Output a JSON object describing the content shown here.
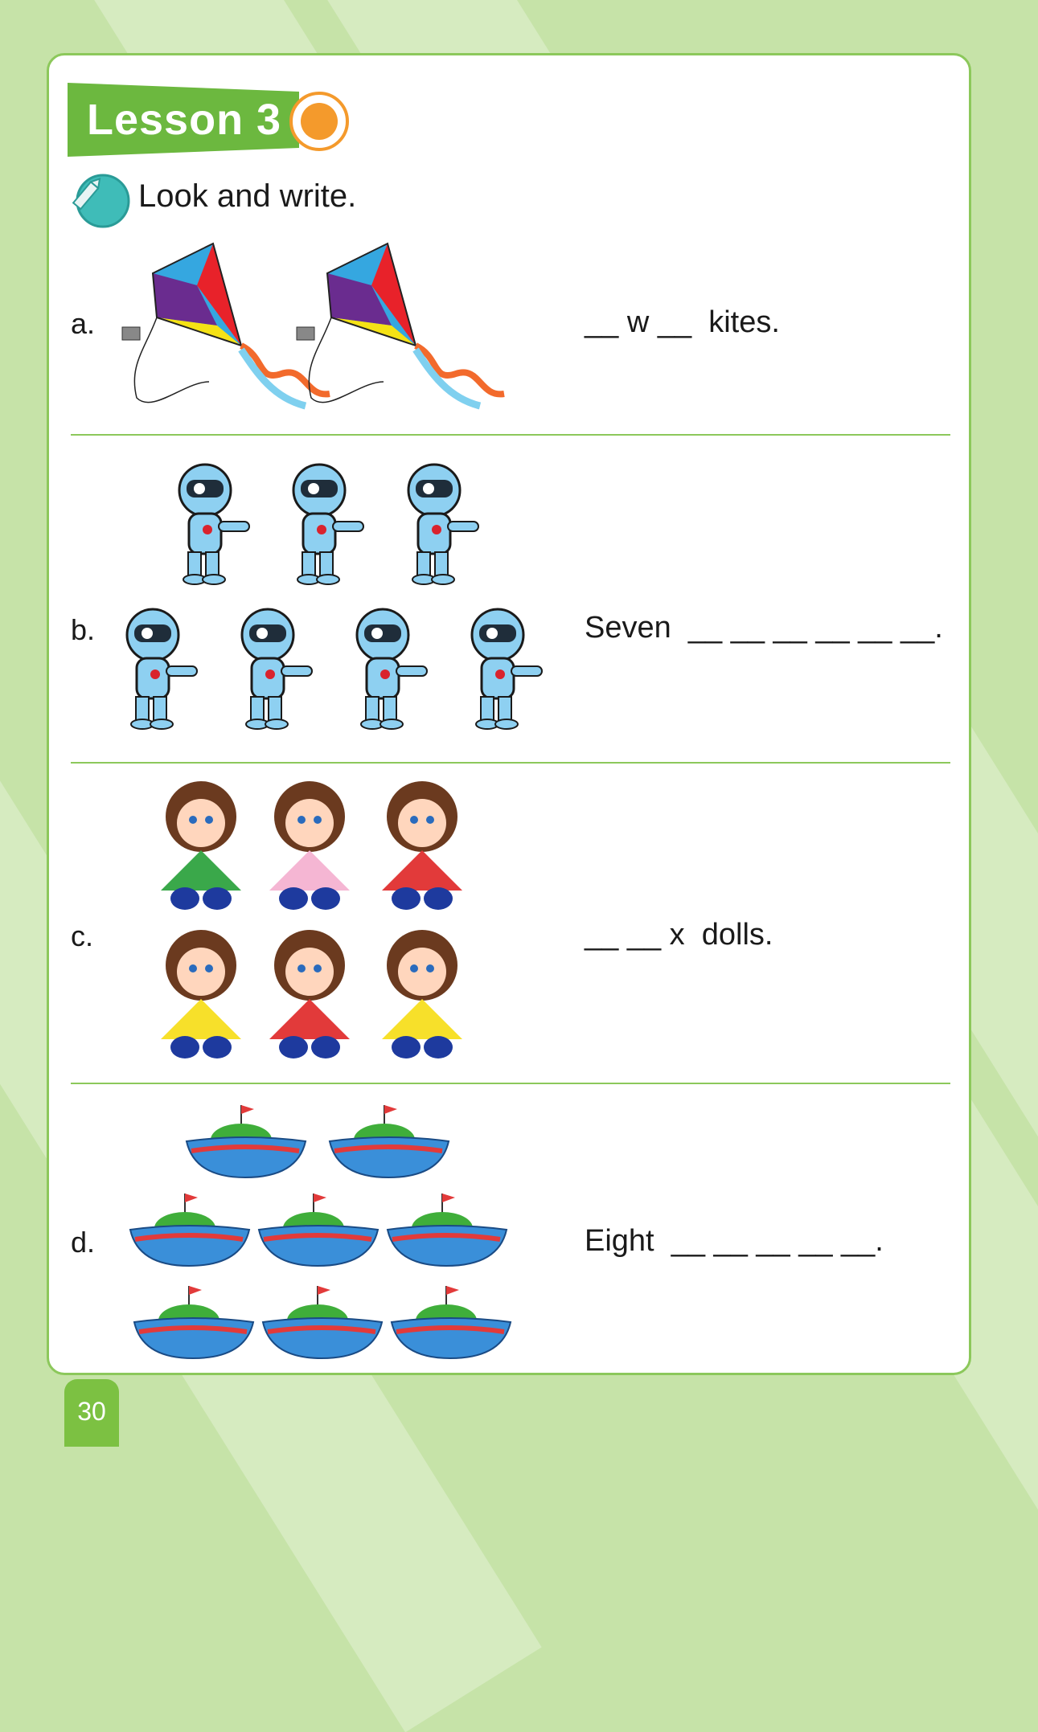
{
  "page": {
    "lesson_title": "Lesson 3",
    "instruction": "Look and write.",
    "page_number": "30"
  },
  "items": [
    {
      "label": "a.",
      "answer": "__ w __  kites.",
      "picture": "kite",
      "count": 2
    },
    {
      "label": "b.",
      "answer": "Seven  __ __ __ __ __ __.",
      "picture": "robot",
      "count": 7
    },
    {
      "label": "c.",
      "answer": "__ __ x  dolls.",
      "picture": "doll",
      "count": 6
    },
    {
      "label": "d.",
      "answer": "Eight  __ __ __ __ __.",
      "picture": "boat",
      "count": 8
    }
  ],
  "icons": [
    "pencil-icon",
    "kite-icon",
    "robot-icon",
    "doll-icon",
    "boat-icon"
  ],
  "colors": {
    "green": "#6cb83f",
    "border": "#8cc85b",
    "orange": "#f49a2c",
    "teal": "#3fbcb8"
  }
}
